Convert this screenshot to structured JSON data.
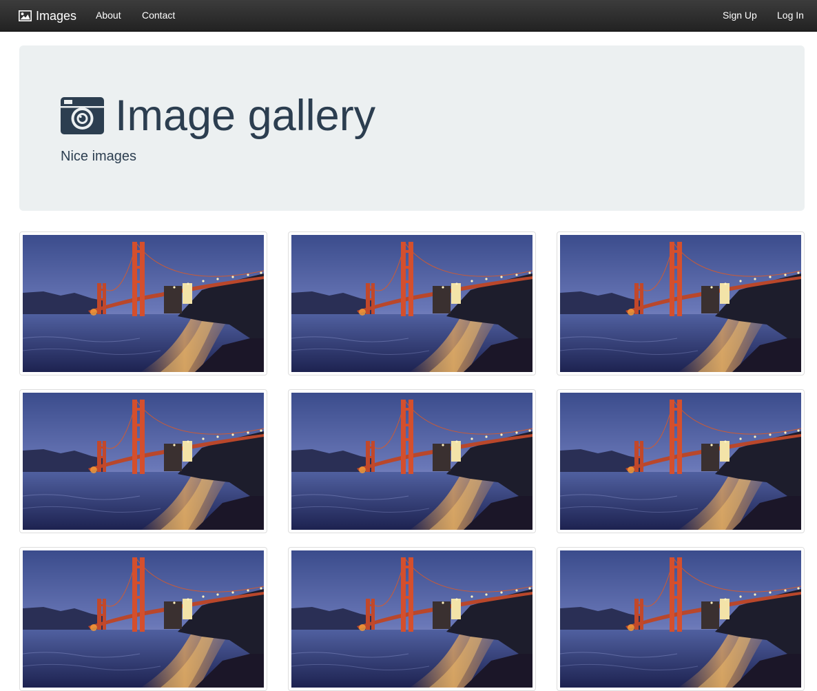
{
  "navbar": {
    "brand_icon": "picture-icon",
    "brand_label": "Images",
    "links": [
      "About",
      "Contact"
    ],
    "right_links": [
      "Sign Up",
      "Log In"
    ]
  },
  "jumbotron": {
    "icon": "camera-icon",
    "title": "Image gallery",
    "subtitle": "Nice images"
  },
  "gallery": {
    "image_subject": "Golden Gate Bridge at dusk",
    "count": 9
  },
  "colors": {
    "navbar_bg": "#222222",
    "jumbotron_bg": "#ecf0f1",
    "text": "#2c3e50"
  }
}
